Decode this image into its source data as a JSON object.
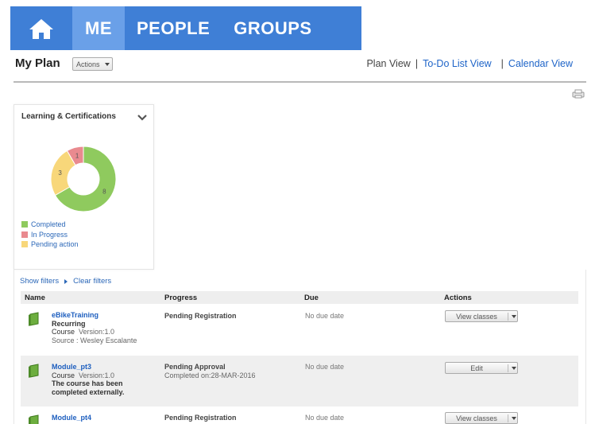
{
  "nav": {
    "home_icon": "home-icon",
    "tabs": [
      {
        "label": "ME",
        "active": true
      },
      {
        "label": "PEOPLE",
        "active": false
      },
      {
        "label": "GROUPS",
        "active": false
      }
    ],
    "background": "#3f7fd6",
    "active_background": "#6aa0e8"
  },
  "header": {
    "title": "My Plan",
    "actions_label": "Actions",
    "views": {
      "plan": "Plan View",
      "todo": "To-Do List View",
      "calendar": "Calendar View"
    }
  },
  "panel": {
    "title": "Learning & Certifications",
    "chart": {
      "segments": [
        {
          "label": "Completed",
          "value": 8,
          "color": "#8fca5e"
        },
        {
          "label": "In Progress",
          "value": 1,
          "color": "#e98a8f"
        },
        {
          "label": "Pending action",
          "value": 3,
          "color": "#f8d77a"
        }
      ]
    },
    "legend": [
      "Completed",
      "In Progress",
      "Pending action"
    ]
  },
  "filters": {
    "show": "Show filters",
    "clear": "Clear filters"
  },
  "table": {
    "columns": [
      "Name",
      "Progress",
      "Due",
      "Actions"
    ],
    "rows": [
      {
        "title": "eBikeTraining",
        "line2": "Recurring",
        "type": "Course",
        "version": "Version:1.0",
        "extra": "Source : Wesley Escalante",
        "status": "Pending Registration",
        "status_sub": "",
        "due": "No due date",
        "action": "View classes"
      },
      {
        "title": "Module_pt3",
        "type": "Course",
        "version": "Version:1.0",
        "extra_bold": "The course has been completed externally.",
        "status": "Pending Approval",
        "status_sub": "Completed on:28-MAR-2016",
        "due": "No due date",
        "action": "Edit"
      },
      {
        "title": "Module_pt4",
        "status": "Pending Registration",
        "due": "No due date",
        "action": "View classes"
      }
    ]
  }
}
